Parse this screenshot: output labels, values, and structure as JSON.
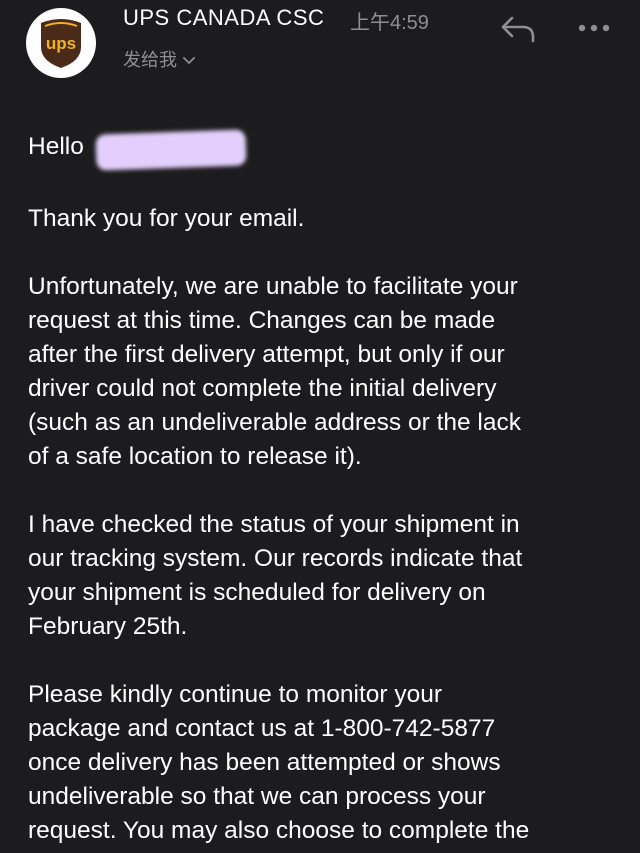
{
  "header": {
    "avatar_logo_text": "ups",
    "sender": "UPS  CANADA CSC",
    "time": "上午4:59",
    "recipient": "发给我",
    "icons": {
      "avatar": "ups-logo-icon",
      "reply": "reply-icon",
      "more": "more-icon",
      "chevron": "chevron-down-icon"
    }
  },
  "email": {
    "greeting": "Hello",
    "paragraphs": [
      [
        "Thank you for your email."
      ],
      [
        "Unfortunately, we are unable to facilitate your",
        "request at this time. Changes can be made",
        "after the first delivery attempt, but only if our",
        "driver could not complete the initial delivery",
        "(such as an undeliverable address or the lack",
        "of a safe location to release it)."
      ],
      [
        "I have checked the status of your shipment in",
        "our tracking system. Our records indicate that",
        "your shipment is scheduled for delivery on",
        "February 25th."
      ],
      [
        "Please kindly continue to monitor your",
        "package and contact us at 1-800-742-5877",
        "once delivery has been attempted or shows",
        "undeliverable so that we can process your",
        "request. You may also choose to complete the"
      ]
    ]
  },
  "colors": {
    "background": "#1c1c1e",
    "text": "#ffffff",
    "secondary": "#8e8e93",
    "redaction": "#e3cffb",
    "ups_brown": "#4a2b1a",
    "ups_gold": "#f4b11d"
  }
}
